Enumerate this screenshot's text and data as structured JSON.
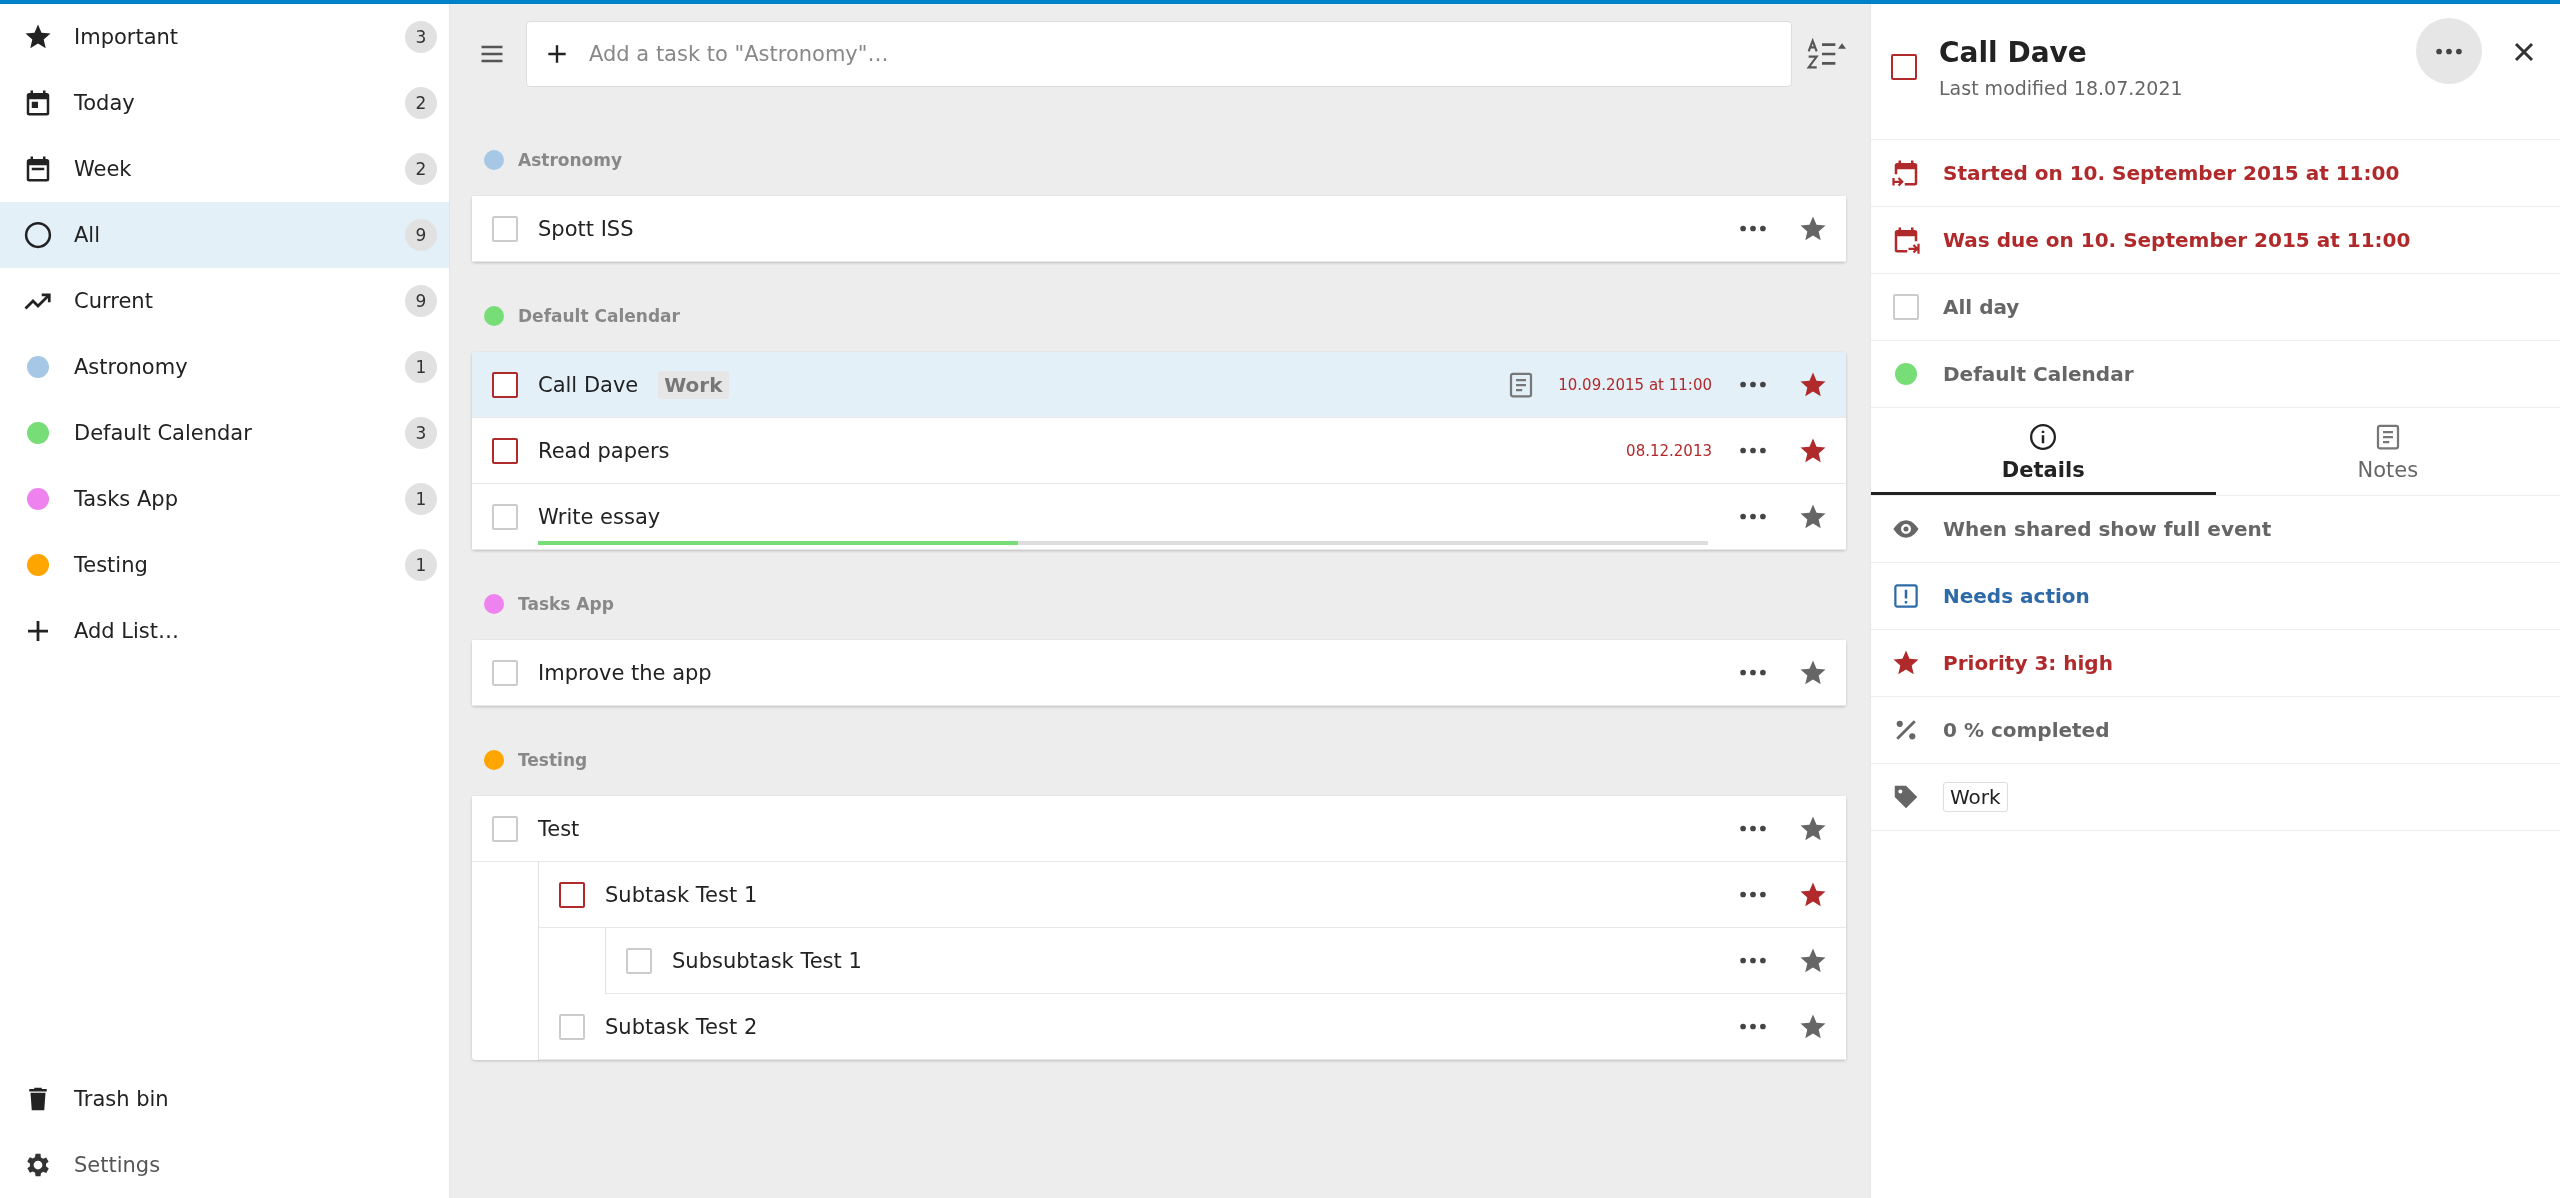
{
  "sidebar": {
    "items": [
      {
        "kind": "important",
        "label": "Important",
        "count": "3",
        "selected": false
      },
      {
        "kind": "today",
        "label": "Today",
        "count": "2",
        "selected": false
      },
      {
        "kind": "week",
        "label": "Week",
        "count": "2",
        "selected": false
      },
      {
        "kind": "all",
        "label": "All",
        "count": "9",
        "selected": true
      },
      {
        "kind": "current",
        "label": "Current",
        "count": "9",
        "selected": false
      },
      {
        "kind": "list",
        "label": "Astronomy",
        "count": "1",
        "color": "#a6c8e6",
        "selected": false
      },
      {
        "kind": "list",
        "label": "Default Calendar",
        "count": "3",
        "color": "#77dd77",
        "selected": false
      },
      {
        "kind": "list",
        "label": "Tasks App",
        "count": "1",
        "color": "#ee82ee",
        "selected": false
      },
      {
        "kind": "list",
        "label": "Testing",
        "count": "1",
        "color": "#ffa500",
        "selected": false
      },
      {
        "kind": "add",
        "label": "Add List…",
        "selected": false
      }
    ],
    "footer": [
      {
        "kind": "trash",
        "label": "Trash bin"
      },
      {
        "kind": "settings",
        "label": "Settings"
      }
    ]
  },
  "toolbar": {
    "placeholder": "Add a task to \"Astronomy\"…"
  },
  "groups": [
    {
      "name": "Astronomy",
      "color": "#a6c8e6",
      "tasks": [
        {
          "title": "Spott ISS",
          "checked": false,
          "high_priority": false,
          "selected": false
        }
      ]
    },
    {
      "name": "Default Calendar",
      "color": "#77dd77",
      "tasks": [
        {
          "title": "Call Dave",
          "tag": "Work",
          "has_notes": true,
          "due": "10.09.2015 at 11:00",
          "checked": false,
          "high_priority": true,
          "selected": true
        },
        {
          "title": "Read papers",
          "due": "08.12.2013",
          "checked": false,
          "high_priority": true,
          "selected": false
        },
        {
          "title": "Write essay",
          "level": 0.41,
          "checked": false,
          "high_priority": false,
          "selected": false
        }
      ]
    },
    {
      "name": "Tasks App",
      "color": "#ee82ee",
      "tasks": [
        {
          "title": "Improve the app",
          "checked": false,
          "high_priority": false,
          "selected": false
        }
      ]
    },
    {
      "name": "Testing",
      "color": "#ffa500",
      "tasks": [
        {
          "title": "Test",
          "checked": false,
          "high_priority": false,
          "selected": false,
          "children": [
            {
              "title": "Subtask Test 1",
              "checked": false,
              "high_priority": true,
              "selected": false,
              "children": [
                {
                  "title": "Subsubtask Test 1",
                  "checked": false,
                  "high_priority": false,
                  "selected": false
                }
              ]
            },
            {
              "title": "Subtask Test 2",
              "checked": false,
              "high_priority": false,
              "selected": false
            }
          ]
        }
      ]
    }
  ],
  "detail": {
    "checked": false,
    "high_priority": true,
    "title": "Call Dave",
    "modified": "Last modified 18.07.2021",
    "rows": [
      {
        "kind": "start",
        "text": "Started on 10. September 2015 at 11:00"
      },
      {
        "kind": "due",
        "text": "Was due on 10. September 2015 at 11:00"
      },
      {
        "kind": "allday",
        "text": "All day",
        "checked": false
      },
      {
        "kind": "calendar",
        "text": "Default Calendar",
        "color": "#77dd77"
      }
    ],
    "tabs": [
      {
        "kind": "info",
        "label": "Details",
        "selected": true
      },
      {
        "kind": "notes",
        "label": "Notes",
        "selected": false
      }
    ],
    "props": [
      {
        "kind": "visibility",
        "text": "When shared show full event"
      },
      {
        "kind": "status",
        "text": "Needs action"
      },
      {
        "kind": "priority",
        "text": "Priority 3: high"
      },
      {
        "kind": "percent",
        "text": "0 % completed"
      },
      {
        "kind": "tags",
        "tags": [
          "Work"
        ]
      }
    ]
  }
}
